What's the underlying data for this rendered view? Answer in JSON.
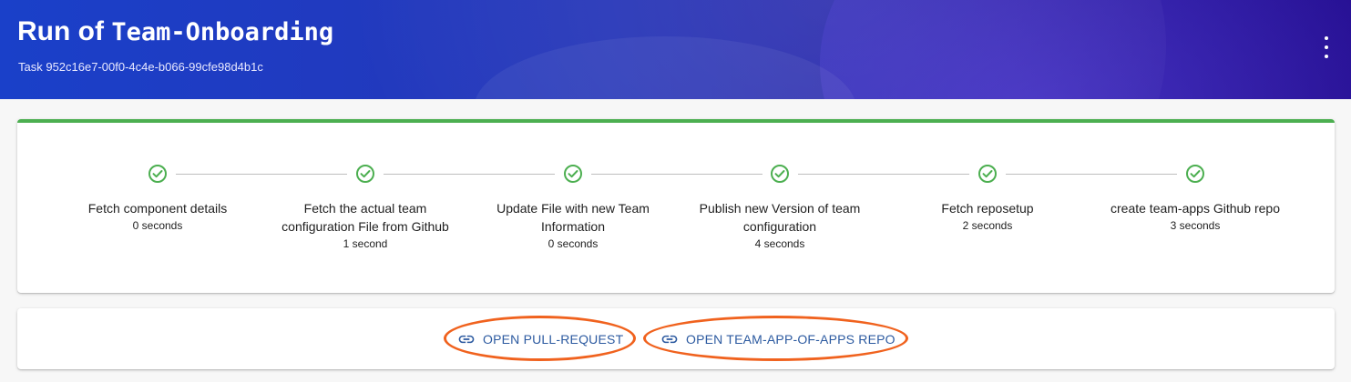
{
  "header": {
    "title_prefix": "Run of ",
    "title_name": "Team-Onboarding",
    "subtitle": "Task 952c16e7-00f0-4c4e-b066-99cfe98d4b1c",
    "menu_icon": "more-vert-icon"
  },
  "steps": [
    {
      "label": "Fetch component details",
      "duration": "0 seconds",
      "status": "completed"
    },
    {
      "label": "Fetch the actual team configuration File from Github",
      "duration": "1 second",
      "status": "completed"
    },
    {
      "label": "Update File with new Team Information",
      "duration": "0 seconds",
      "status": "completed"
    },
    {
      "label": "Publish new Version of team configuration",
      "duration": "4 seconds",
      "status": "completed"
    },
    {
      "label": "Fetch reposetup",
      "duration": "2 seconds",
      "status": "completed"
    },
    {
      "label": "create team-apps Github repo",
      "duration": "3 seconds",
      "status": "completed"
    }
  ],
  "actions": {
    "open_pr_label": "OPEN PULL-REQUEST",
    "open_repo_label": "OPEN TEAM-APP-OF-APPS REPO",
    "icon": "link-icon"
  },
  "colors": {
    "success": "#4caf50",
    "link": "#2c5aa0",
    "highlight": "#f0621e"
  }
}
